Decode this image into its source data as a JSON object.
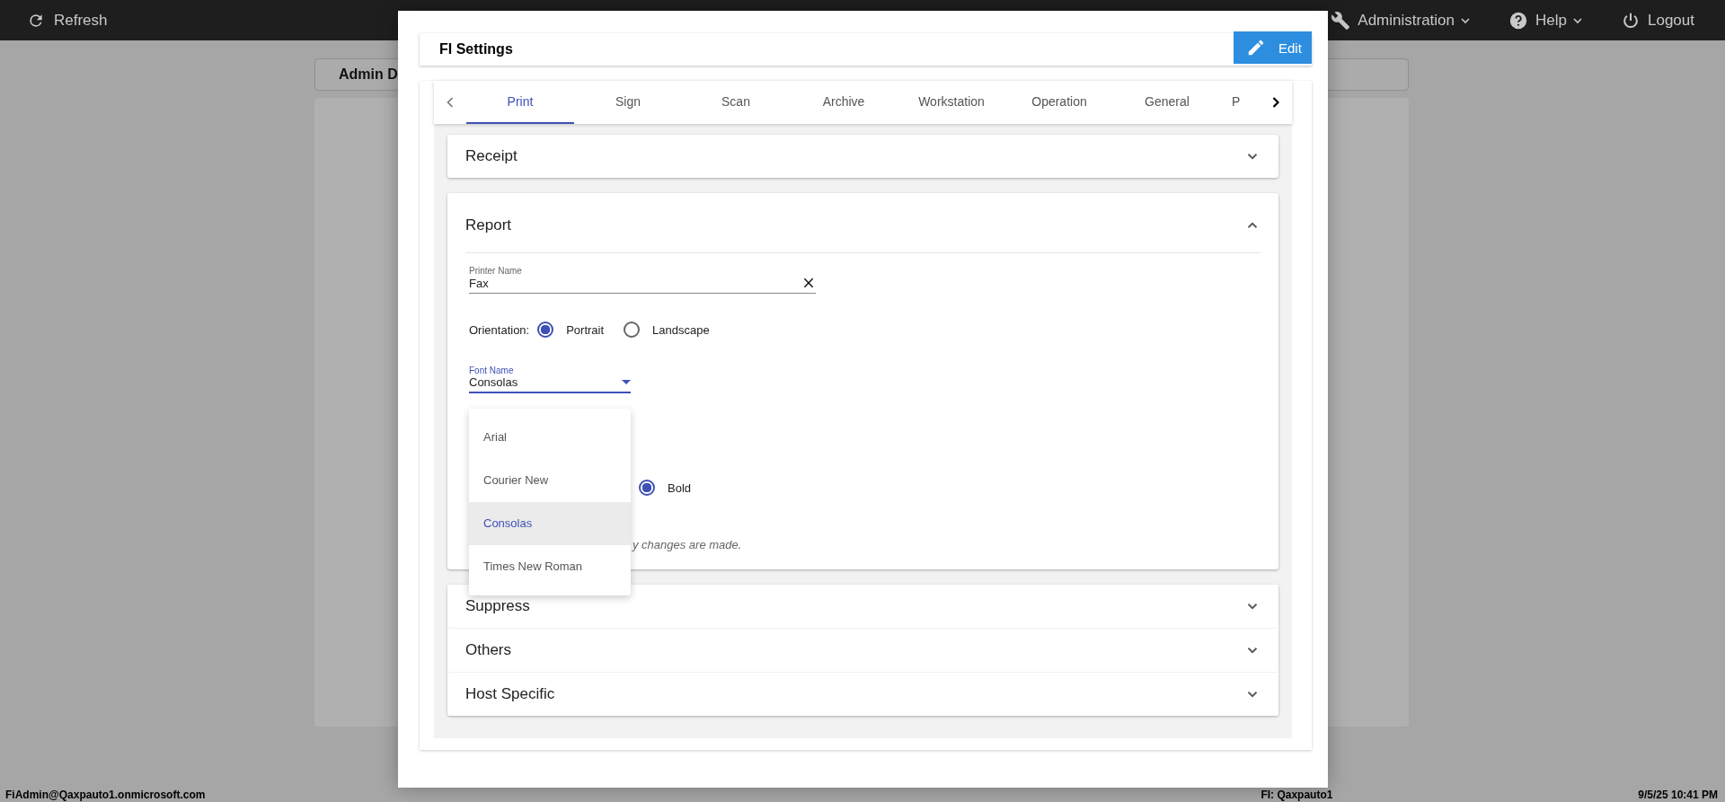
{
  "top_bar": {
    "refresh": "Refresh",
    "menus": [
      {
        "label": "Administration",
        "dropdown": true
      },
      {
        "label": "Help",
        "dropdown": true
      },
      {
        "label": "Logout",
        "dropdown": false
      }
    ]
  },
  "background": {
    "card_title": "Admin D"
  },
  "dialog": {
    "title": "FI Settings",
    "edit_button": "Edit",
    "tabs": [
      {
        "label": "Print",
        "selected": true
      },
      {
        "label": "Sign",
        "selected": false
      },
      {
        "label": "Scan",
        "selected": false
      },
      {
        "label": "Archive",
        "selected": false
      },
      {
        "label": "Workstation",
        "selected": false
      },
      {
        "label": "Operation",
        "selected": false
      },
      {
        "label": "General",
        "selected": false
      },
      {
        "label": "P",
        "selected": false
      }
    ],
    "sections": [
      {
        "title": "Receipt",
        "expanded": false
      },
      {
        "title": "Report",
        "expanded": true,
        "printer_name": {
          "label": "Printer Name",
          "value": "Fax"
        },
        "orientation": {
          "label": "Orientation:",
          "options": [
            {
              "label": "Portrait",
              "selected": true
            },
            {
              "label": "Landscape",
              "selected": false
            }
          ]
        },
        "font_name": {
          "label": "Font Name",
          "value": "Consolas"
        },
        "font_style": {
          "options": [
            {
              "label": "Bold",
              "selected": true
            }
          ]
        },
        "note": "y changes are made.",
        "menu": {
          "options": [
            {
              "label": "Arial",
              "selected": false
            },
            {
              "label": "Courier New",
              "selected": false
            },
            {
              "label": "Consolas",
              "selected": true
            },
            {
              "label": "Times New Roman",
              "selected": false
            }
          ]
        }
      },
      {
        "title": "Suppress",
        "expanded": false
      },
      {
        "title": "Others",
        "expanded": false
      },
      {
        "title": "Host Specific",
        "expanded": false
      }
    ]
  },
  "status_bar": {
    "user": "FiAdmin@Qaxpauto1.onmicrosoft.com",
    "institution": "FI: Qaxpauto1",
    "datetime": "9/5/25 10:41 PM"
  }
}
